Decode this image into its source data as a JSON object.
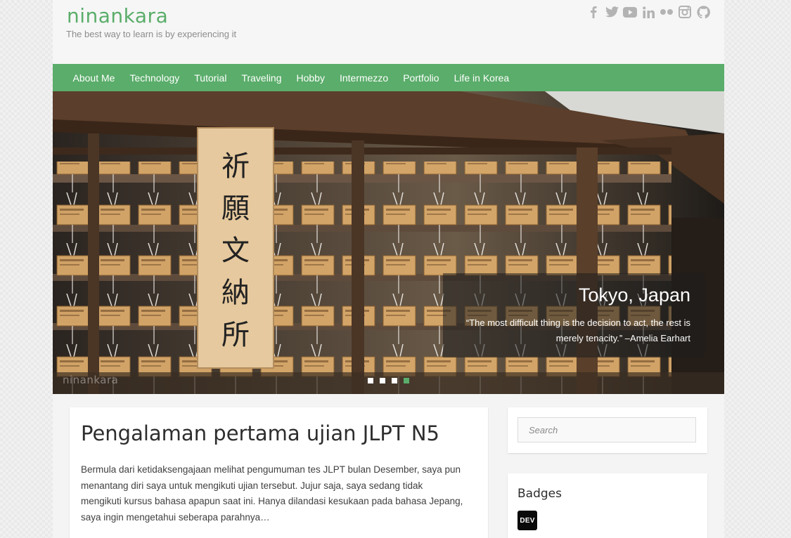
{
  "site": {
    "title": "ninankara",
    "tagline": "The best way to learn is by experiencing it"
  },
  "social": [
    "facebook-icon",
    "twitter-icon",
    "youtube-icon",
    "linkedin-icon",
    "flickr-icon",
    "instagram-icon",
    "github-icon"
  ],
  "nav": {
    "items": [
      {
        "label": "About Me"
      },
      {
        "label": "Technology"
      },
      {
        "label": "Tutorial"
      },
      {
        "label": "Traveling"
      },
      {
        "label": "Hobby"
      },
      {
        "label": "Intermezzo"
      },
      {
        "label": "Portfolio"
      },
      {
        "label": "Life in Korea"
      }
    ]
  },
  "slider": {
    "caption_title": "Tokyo, Japan",
    "caption_quote": "“The most difficult thing is the decision to act, the rest is merely tenacity.” –Amelia Earhart",
    "sign_text": "祈願文納所",
    "watermark": "ninankara",
    "slide_count": 4,
    "active_slide": 4
  },
  "post": {
    "title": "Pengalaman pertama ujian JLPT N5",
    "excerpt": "Bermula dari ketidaksengajaan melihat pengumuman tes JLPT bulan Desember, saya pun menantang diri saya untuk mengikuti ujian tersebut. Jujur saja, saya sedang tidak mengikuti kursus bahasa apapun saat ini. Hanya dilandasi kesukaan pada bahasa Jepang, saya ingin mengetahui seberapa parahnya…"
  },
  "sidebar": {
    "search_placeholder": "Search",
    "badges_title": "Badges",
    "dev_badge": "DEV"
  },
  "colors": {
    "accent": "#5aad6a",
    "social_icon": "#b3b3b3"
  }
}
